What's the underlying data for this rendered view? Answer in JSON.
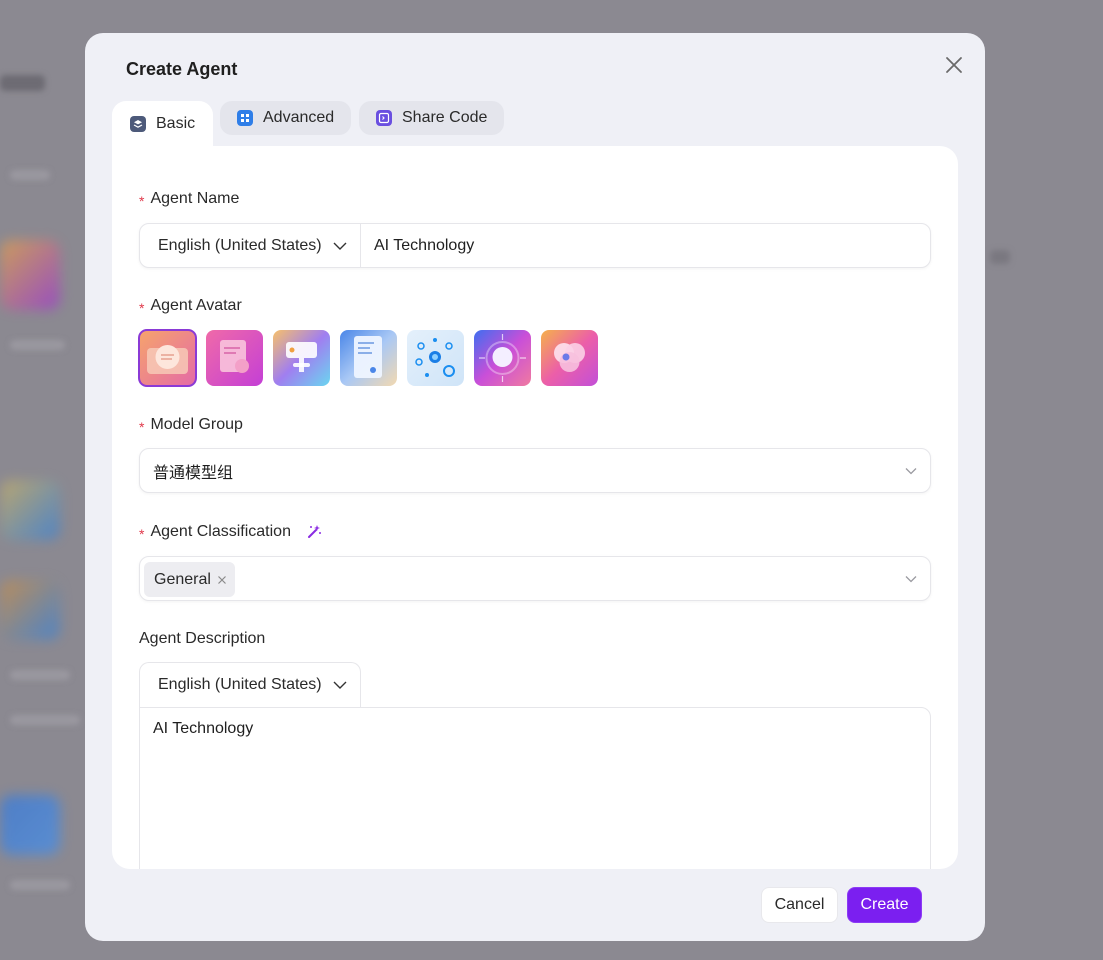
{
  "modal": {
    "title": "Create Agent",
    "tabs": [
      {
        "label": "Basic",
        "icon": "layers-icon",
        "active": true
      },
      {
        "label": "Advanced",
        "icon": "grid-icon",
        "active": false
      },
      {
        "label": "Share Code",
        "icon": "code-icon",
        "active": false
      }
    ]
  },
  "form": {
    "agent_name": {
      "label": "Agent Name",
      "language": "English (United States)",
      "value": "AI Technology"
    },
    "agent_avatar": {
      "label": "Agent Avatar",
      "selected_index": 0,
      "avatars": [
        "avatar-bubble-icon",
        "avatar-document-icon",
        "avatar-signboard-icon",
        "avatar-report-icon",
        "avatar-network-icon",
        "avatar-orb-icon",
        "avatar-circles-icon"
      ]
    },
    "model_group": {
      "label": "Model Group",
      "value": "普通模型组"
    },
    "agent_classification": {
      "label": "Agent Classification",
      "tags": [
        "General"
      ]
    },
    "agent_description": {
      "label": "Agent Description",
      "language": "English (United States)",
      "value": "AI Technology"
    }
  },
  "footer": {
    "cancel_label": "Cancel",
    "create_label": "Create"
  },
  "colors": {
    "accent": "#7b1ff0",
    "required": "#e0384a",
    "modal_bg": "#eff0f6"
  }
}
